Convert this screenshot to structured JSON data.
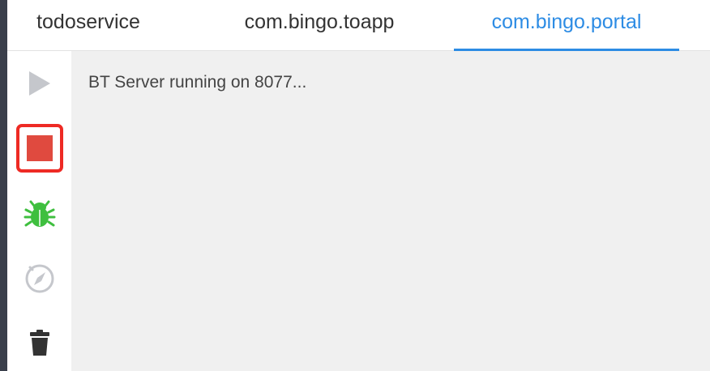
{
  "tabs": [
    {
      "label": "todoservice",
      "active": false
    },
    {
      "label": "com.bingo.toapp",
      "active": false
    },
    {
      "label": "com.bingo.portal",
      "active": true
    }
  ],
  "toolbar": {
    "icons": [
      "play-icon",
      "stop-icon",
      "bug-icon",
      "compass-icon",
      "trash-icon"
    ],
    "selected": "stop-icon"
  },
  "console": {
    "lines": [
      "BT Server running on 8077..."
    ]
  },
  "colors": {
    "accent": "#2d8ce4",
    "stop": "#e04a3f",
    "stop_highlight": "#ee2a24",
    "debug": "#3fbf3f",
    "muted_icon": "#c5c7cc",
    "console_bg": "#f0f0f0"
  }
}
